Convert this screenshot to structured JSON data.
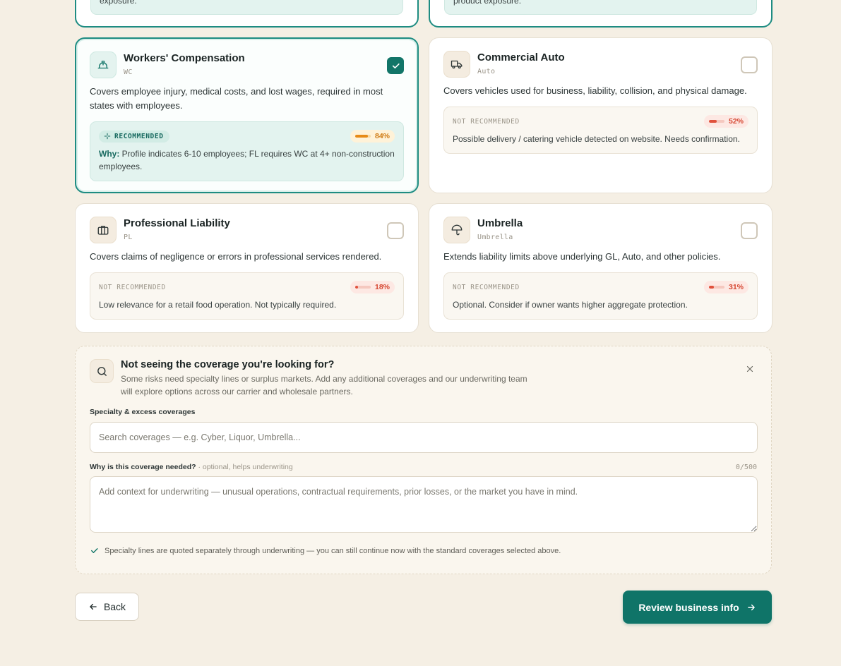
{
  "top_cards": {
    "left_text": "exposure.",
    "right_text": "product exposure."
  },
  "cards": [
    {
      "title": "Workers' Compensation",
      "code": "WC",
      "icon": "hard-hat-icon",
      "selected": true,
      "description": "Covers employee injury, medical costs, and lost wages, required in most states with employees.",
      "status": "RECOMMENDED",
      "score": "84%",
      "score_value": 0.84,
      "why_label": "Why:",
      "reason": "Profile indicates 6-10 employees; FL requires WC at 4+ non-construction employees."
    },
    {
      "title": "Commercial Auto",
      "code": "Auto",
      "icon": "truck-icon",
      "selected": false,
      "description": "Covers vehicles used for business, liability, collision, and physical damage.",
      "status": "NOT RECOMMENDED",
      "score": "52%",
      "score_value": 0.52,
      "reason": "Possible delivery / catering vehicle detected on website. Needs confirmation."
    },
    {
      "title": "Professional Liability",
      "code": "PL",
      "icon": "briefcase-icon",
      "selected": false,
      "description": "Covers claims of negligence or errors in professional services rendered.",
      "status": "NOT RECOMMENDED",
      "score": "18%",
      "score_value": 0.18,
      "reason": "Low relevance for a retail food operation. Not typically required."
    },
    {
      "title": "Umbrella",
      "code": "Umbrella",
      "icon": "umbrella-icon",
      "selected": false,
      "description": "Extends liability limits above underlying GL, Auto, and other policies.",
      "status": "NOT RECOMMENDED",
      "score": "31%",
      "score_value": 0.31,
      "reason": "Optional. Consider if owner wants higher aggregate protection."
    }
  ],
  "specialty": {
    "title": "Not seeing the coverage you're looking for?",
    "subtitle": "Some risks need specialty lines or surplus markets. Add any additional coverages and our underwriting team will explore options across our carrier and wholesale partners.",
    "search_label": "Specialty & excess coverages",
    "search_placeholder": "Search coverages — e.g. Cyber, Liquor, Umbrella...",
    "why_label": "Why is this coverage needed?",
    "why_optional": "· optional, helps underwriting",
    "counter": "0/500",
    "textarea_placeholder": "Add context for underwriting — unusual operations, contractual requirements, prior losses, or the market you have in mind.",
    "note": "Specialty lines are quoted separately through underwriting — you can still continue now with the standard coverages selected above."
  },
  "nav": {
    "back_label": "Back",
    "next_label": "Review business info"
  },
  "colors": {
    "accent": "#0f7468",
    "background": "#f5efe4",
    "score_orange": "#e78a16",
    "score_red": "#e0513c"
  }
}
